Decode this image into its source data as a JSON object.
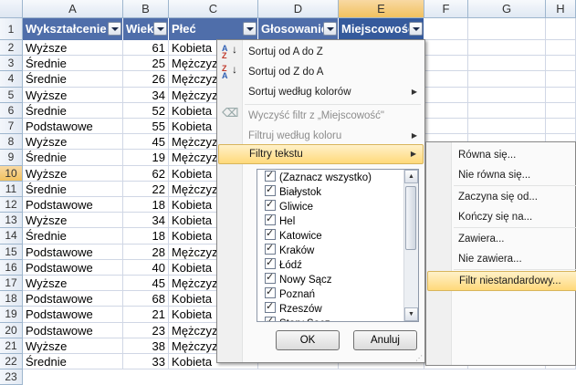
{
  "columns": [
    "A",
    "B",
    "C",
    "D",
    "E",
    "F",
    "G",
    "H"
  ],
  "row_numbers": [
    "1",
    "2",
    "3",
    "4",
    "5",
    "6",
    "7",
    "8",
    "9",
    "10",
    "11",
    "12",
    "13",
    "14",
    "15",
    "16",
    "17",
    "18",
    "19",
    "20",
    "21",
    "22",
    "23"
  ],
  "headers": [
    "Wykształcenie",
    "Wiek",
    "Płeć",
    "Głosowanie",
    "Miejscowość"
  ],
  "rows": [
    [
      "Wyższe",
      "61",
      "Kobieta"
    ],
    [
      "Średnie",
      "25",
      "Mężczyzna"
    ],
    [
      "Średnie",
      "26",
      "Mężczyzna"
    ],
    [
      "Wyższe",
      "34",
      "Mężczyzna"
    ],
    [
      "Średnie",
      "52",
      "Kobieta"
    ],
    [
      "Podstawowe",
      "55",
      "Kobieta"
    ],
    [
      "Wyższe",
      "45",
      "Mężczyzna"
    ],
    [
      "Średnie",
      "19",
      "Mężczyzna"
    ],
    [
      "Wyższe",
      "62",
      "Kobieta"
    ],
    [
      "Średnie",
      "22",
      "Mężczyzna"
    ],
    [
      "Podstawowe",
      "18",
      "Kobieta"
    ],
    [
      "Wyższe",
      "34",
      "Kobieta"
    ],
    [
      "Średnie",
      "18",
      "Kobieta"
    ],
    [
      "Podstawowe",
      "28",
      "Mężczyzna"
    ],
    [
      "Podstawowe",
      "40",
      "Kobieta"
    ],
    [
      "Wyższe",
      "45",
      "Mężczyzna"
    ],
    [
      "Podstawowe",
      "68",
      "Kobieta"
    ],
    [
      "Podstawowe",
      "21",
      "Kobieta"
    ],
    [
      "Podstawowe",
      "23",
      "Mężczyzna"
    ],
    [
      "Wyższe",
      "38",
      "Mężczyzna"
    ],
    [
      "Średnie",
      "33",
      "Kobieta"
    ]
  ],
  "menu": {
    "sort_az": "Sortuj od A do Z",
    "sort_za": "Sortuj od Z do A",
    "sort_color": "Sortuj według kolorów",
    "clear_filter": "Wyczyść filtr z „Miejscowość\"",
    "filter_color": "Filtruj według koloru",
    "text_filters": "Filtry tekstu",
    "list_items": [
      "(Zaznacz wszystko)",
      "Białystok",
      "Gliwice",
      "Hel",
      "Katowice",
      "Kraków",
      "Łódź",
      "Nowy Sącz",
      "Poznań",
      "Rzeszów",
      "Stary Sącz"
    ],
    "ok": "OK",
    "cancel": "Anuluj"
  },
  "submenu": {
    "items": [
      "Równa się...",
      "Nie równa się...",
      "Zaczyna się od...",
      "Kończy się na...",
      "Zawiera...",
      "Nie zawiera...",
      "Filtr niestandardowy..."
    ]
  },
  "colors": {
    "header_fill": "#4f6eaa",
    "highlight": "#ffd97a",
    "selected_header": "#f1c15f"
  }
}
